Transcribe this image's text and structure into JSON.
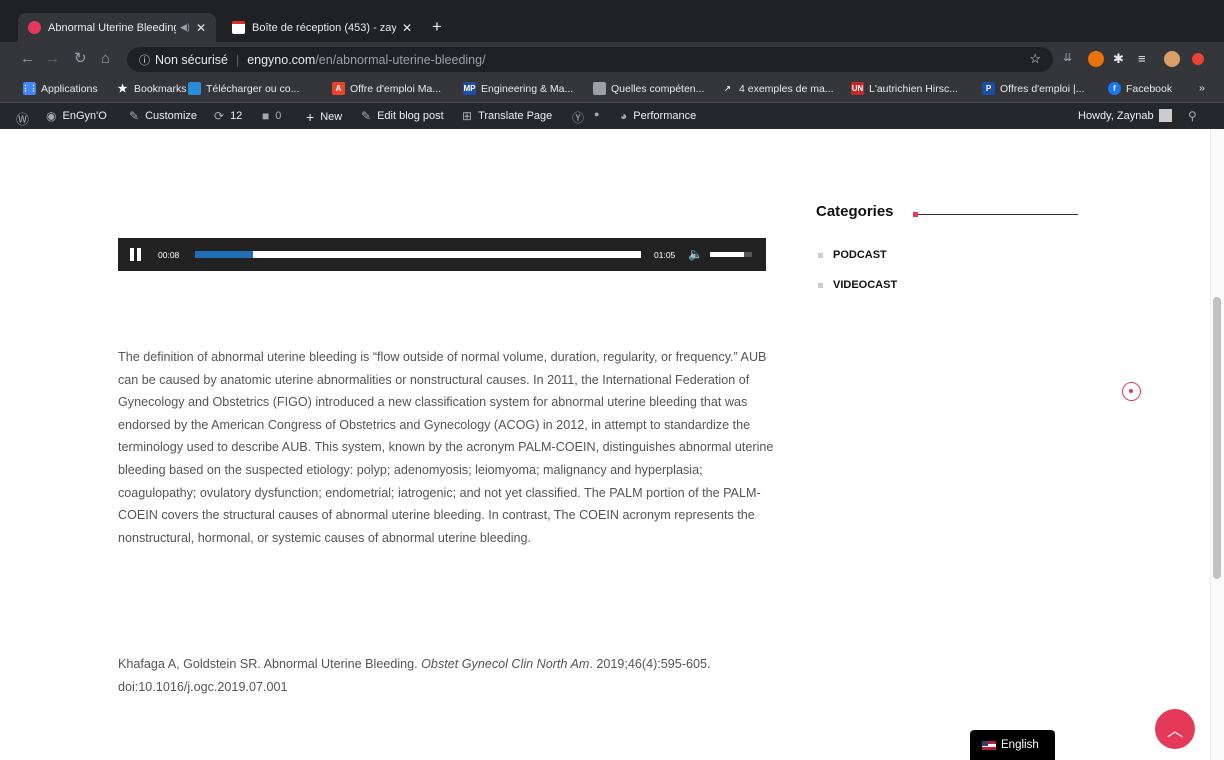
{
  "browser": {
    "tabs": [
      {
        "title": "Abnormal Uterine Bleeding",
        "active": true,
        "audio_icon": "speaker-icon"
      },
      {
        "title": "Boîte de réception (453) - zay",
        "active": false
      }
    ],
    "new_tab_label": "+",
    "address": {
      "security_label": "Non sécurisé",
      "domain": "engyno.com",
      "path": "/en/abnormal-uterine-bleeding/"
    },
    "bookmarks": [
      "Applications",
      "Bookmarks",
      "Télécharger ou co...",
      "Offre d'emploi Ma...",
      "Engineering & Ma...",
      "Quelles compéten...",
      "4 exemples de ma...",
      "L'autrichien Hirsc...",
      "Offres d'emploi |...",
      "Facebook"
    ],
    "bookmarks_overflow": "»"
  },
  "adminbar": {
    "site": "EnGyn'O",
    "customize": "Customize",
    "updates_count": "12",
    "comments_count": "0",
    "new": "New",
    "edit": "Edit blog post",
    "translate": "Translate Page",
    "performance": "Performance",
    "howdy": "Howdy, Zaynab"
  },
  "player": {
    "current_time": "00:08",
    "duration": "01:05",
    "progress_fraction": 0.13,
    "volume_fraction": 0.8
  },
  "article": {
    "paragraph": "The definition of abnormal uterine bleeding is “flow outside of normal volume, duration, regularity, or frequency.” AUB can be caused by anatomic uterine abnormalities or nonstructural causes. In 2011, the International Federation of Gynecology and Obstetrics (FIGO) introduced a new classification system for abnormal uterine bleeding that was endorsed by the American Congress of Obstetrics and Gynecology (ACOG) in 2012, in attempt to standardize the terminology used to describe AUB. This system, known by the acronym PALM-COEIN, distinguishes abnormal uterine bleeding based on the suspected etiology: polyp; adenomyosis; leiomyoma; malignancy and hyperplasia; coagulopathy; ovulatory dysfunction; endometrial; iatrogenic; and not yet classified. The PALM portion of the PALM-COEIN covers the structural causes of abnormal uterine bleeding. In contrast, The COEIN acronym represents the nonstructural, hormonal, or systemic causes of abnormal uterine bleeding.",
    "citation_pre": "Khafaga A, Goldstein SR. Abnormal Uterine Bleeding. ",
    "citation_journal": "Obstet Gynecol Clin North Am",
    "citation_post": ". 2019;46(4):595-605. doi:10.1016/j.ogc.2019.07.001"
  },
  "sidebar": {
    "title": "Categories",
    "items": [
      "PODCAST",
      "VIDEOCAST"
    ]
  },
  "language_switcher": "English",
  "colors": {
    "accent": "#e5395a",
    "player_progress": "#1e6fb6",
    "admin_bar": "#23282d"
  }
}
